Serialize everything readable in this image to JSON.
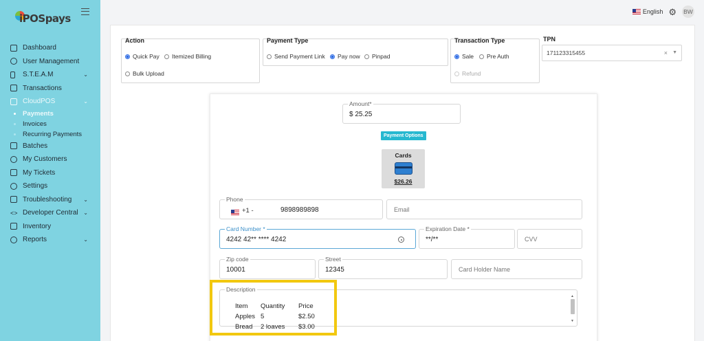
{
  "app": {
    "logo_text": "iPOSpays",
    "menu_icon": "hamburger-icon"
  },
  "topbar": {
    "language": "English",
    "language_flag": "us-flag-icon",
    "settings_icon": "gear-icon",
    "user_initials": "BW"
  },
  "sidebar": {
    "items": [
      {
        "label": "Dashboard",
        "icon": "home-icon"
      },
      {
        "label": "User Management",
        "icon": "users-icon"
      },
      {
        "label": "S.T.E.A.M",
        "icon": "device-icon",
        "has_children": true
      },
      {
        "label": "Transactions",
        "icon": "layers-icon"
      },
      {
        "label": "CloudPOS",
        "icon": "cloud-pos-icon",
        "has_children": true,
        "expanded": true
      },
      {
        "label": "Batches",
        "icon": "document-icon"
      },
      {
        "label": "My Customers",
        "icon": "person-icon"
      },
      {
        "label": "My Tickets",
        "icon": "ticket-icon"
      },
      {
        "label": "Settings",
        "icon": "gear-icon"
      },
      {
        "label": "Troubleshooting",
        "icon": "toolbox-icon",
        "has_children": true
      },
      {
        "label": "Developer Central",
        "icon": "code-icon",
        "has_children": true
      },
      {
        "label": "Inventory",
        "icon": "inventory-icon"
      },
      {
        "label": "Reports",
        "icon": "chat-icon",
        "has_children": true
      }
    ],
    "cloudpos_children": [
      {
        "label": "Payments",
        "active": true
      },
      {
        "label": "Invoices"
      },
      {
        "label": "Recurring Payments"
      }
    ]
  },
  "action": {
    "title": "Action",
    "options": [
      "Quick Pay",
      "Itemized Billing",
      "Bulk Upload"
    ],
    "selected": "Quick Pay"
  },
  "payment_type": {
    "title": "Payment Type",
    "options": [
      "Send Payment Link",
      "Pay now",
      "Pinpad"
    ],
    "selected": "Pay now"
  },
  "transaction_type": {
    "title": "Transaction Type",
    "options": [
      "Sale",
      "Pre Auth",
      "Refund"
    ],
    "selected": "Sale"
  },
  "tpn": {
    "label": "TPN",
    "value": "171123315455"
  },
  "payment_form": {
    "amount_label": "Amount*",
    "amount_value": "$ 25.25",
    "payment_options_label": "Payment Options",
    "card_option": {
      "title": "Cards",
      "amount": "$26.26"
    },
    "phone_label": "Phone",
    "phone_country_code": "+1 -",
    "phone_value": "9898989898",
    "email_placeholder": "Email",
    "card_number_label": "Card Number *",
    "card_number_value": "4242 42** **** 4242",
    "expiration_label": "Expiration Date *",
    "expiration_value": "**/**",
    "cvv_placeholder": "CVV",
    "zip_label": "Zip code",
    "zip_value": "10001",
    "street_label": "Street",
    "street_value": "12345",
    "holder_placeholder": "Card Holder Name",
    "description_label": "Description",
    "description_table": {
      "headers": [
        "Item",
        "Quantity",
        "Price"
      ],
      "rows": [
        [
          "Apples",
          "5",
          "$2.50"
        ],
        [
          "Bread",
          "2 loaves",
          "$3.00"
        ]
      ]
    }
  },
  "colors": {
    "sidebar_bg": "#7fd3e1",
    "accent": "#26b8d0",
    "highlight": "#f2c80f",
    "radio_selected": "#2d6be4"
  }
}
